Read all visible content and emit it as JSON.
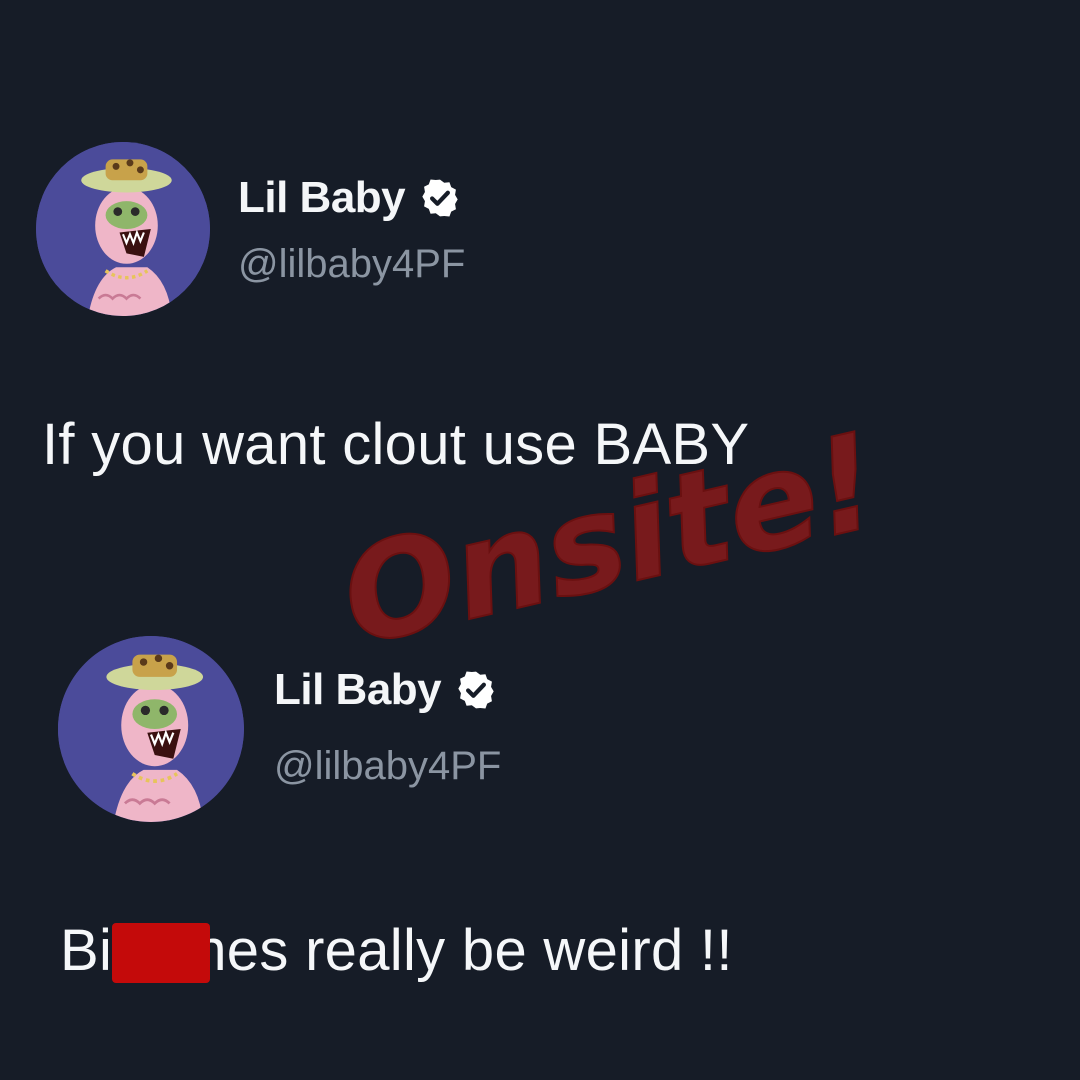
{
  "tweets": [
    {
      "display_name": "Lil Baby",
      "handle": "@lilbaby4PF",
      "text": "If you want clout use BABY",
      "avatar_icon": "ape-avatar",
      "verified_icon": "verified-badge-icon"
    },
    {
      "display_name": "Lil Baby",
      "handle": "@lilbaby4PF",
      "text": "Bi     hes really be weird !!",
      "avatar_icon": "ape-avatar",
      "verified_icon": "verified-badge-icon"
    }
  ],
  "watermark": {
    "text": "Onsite!",
    "color": "#8e1a1a"
  },
  "colors": {
    "background": "#161c27",
    "text": "#f5f7f9",
    "handle": "#8b95a2",
    "censor": "#c40a0a",
    "avatar_bg": "#4b4b9a"
  }
}
